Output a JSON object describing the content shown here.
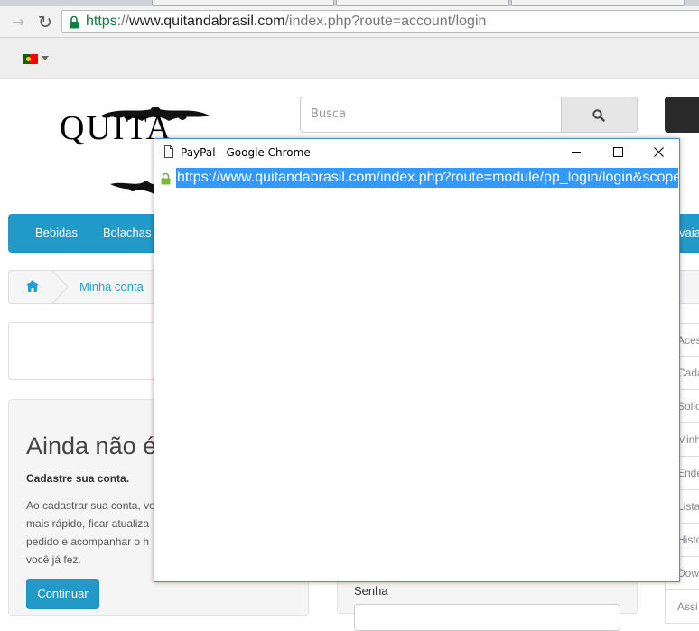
{
  "browser": {
    "url_scheme": "https",
    "url_separator": "://",
    "url_domain": "www.quitandabrasil.com",
    "url_path": "/index.php?route=account/login"
  },
  "site": {
    "language_flag": "pt-flag-icon",
    "logo_text": "QUITA",
    "search": {
      "placeholder": "Busca"
    },
    "menu": [
      "Bebidas",
      "Bolachas",
      "vaia"
    ],
    "breadcrumb": [
      "Minha conta"
    ],
    "new_customer": {
      "title": "Ainda não é",
      "subtitle": "Cadastre sua conta.",
      "lines": [
        "Ao cadastrar sua conta, vo",
        "mais rápido, ficar atualiza",
        "pedido e acompanhar o h",
        "você já fez."
      ],
      "button": "Continuar"
    },
    "login": {
      "password_label": "Senha"
    },
    "account_sidebar": [
      "Aces",
      "Cada",
      "Solic",
      "Minh",
      "Ende",
      "Lista",
      "Histo",
      "Dow",
      "Assi"
    ]
  },
  "popup": {
    "title": "PayPal - Google Chrome",
    "url": "https://www.quitandabrasil.com/index.php?route=module/pp_login/login&scope"
  },
  "colors": {
    "brand_blue": "#229ac8",
    "popup_border": "#4a90d9",
    "selection": "#3399ff"
  }
}
